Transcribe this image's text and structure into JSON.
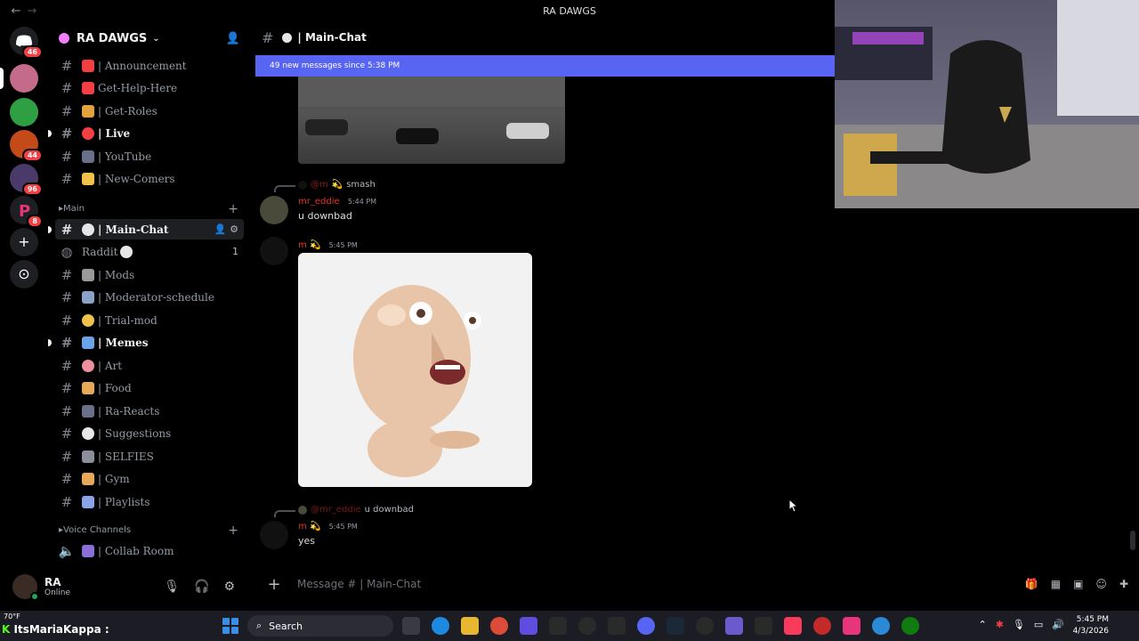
{
  "window": {
    "title": "RA DAWGS",
    "back": "←",
    "forward": "→"
  },
  "servers": {
    "badges": [
      "46",
      "44",
      "96",
      "8"
    ]
  },
  "server": {
    "name": "RA DAWGS"
  },
  "channels": [
    {
      "label": "| Announcement",
      "emoji_color": "#f23f43"
    },
    {
      "label": "Get-Help-Here",
      "emoji_color": "#f23f43"
    },
    {
      "label": "| Get-Roles",
      "emoji_color": "#e3a33c"
    },
    {
      "label": "| Live",
      "emoji_color": "#f23f43"
    },
    {
      "label": "| YouTube",
      "emoji_color": "#6a6f8a"
    },
    {
      "label": "| New-Comers",
      "emoji_color": "#f0c14b"
    }
  ],
  "category_main": "Main",
  "channels2": [
    {
      "label": "| Main-Chat",
      "emoji_color": "#e6e6e6"
    },
    {
      "label": "Raddit",
      "emoji_color": "#e6e6e6",
      "count": "1"
    },
    {
      "label": "| Mods",
      "emoji_color": "#9a9a9a"
    },
    {
      "label": "| Moderator-schedule",
      "emoji_color": "#8aa2c8"
    },
    {
      "label": "| Trial-mod",
      "emoji_color": "#f0c14b"
    },
    {
      "label": "| Memes",
      "emoji_color": "#6aa3e8"
    },
    {
      "label": "| Art",
      "emoji_color": "#f08fa0"
    },
    {
      "label": "| Food",
      "emoji_color": "#e8a85a"
    },
    {
      "label": "| Ra-Reacts",
      "emoji_color": "#6a6f8a"
    },
    {
      "label": "| Suggestions",
      "emoji_color": "#e6e6e6"
    },
    {
      "label": "| SELFIES",
      "emoji_color": "#8a8f9a"
    },
    {
      "label": "| Gym",
      "emoji_color": "#e8a85a"
    },
    {
      "label": "| Playlists",
      "emoji_color": "#8aa2e8"
    }
  ],
  "category_voice": "Voice Channels",
  "voice_channels": [
    {
      "label": "| Collab Room",
      "emoji_color": "#8a6fd8"
    }
  ],
  "user": {
    "name": "RA",
    "status": "Online"
  },
  "chat": {
    "channel_title": "| Main-Chat",
    "new_messages": "49 new messages since 5:38 PM",
    "messages": [
      {
        "reply_text": "smash",
        "author": "mr_eddie",
        "time": "5:44 PM",
        "text": "u downbad"
      },
      {
        "author": "m",
        "time": "5:45 PM"
      },
      {
        "reply_author": "@mr_eddie",
        "reply_text": "u downbad",
        "author": "m",
        "time": "5:45 PM",
        "text": "yes"
      }
    ],
    "input_placeholder": "Message # | Main-Chat"
  },
  "taskbar": {
    "weather": "70°F",
    "streamer_name": "ItsMariaKappa :",
    "search": "Search",
    "time": "5:45 PM",
    "date": "4/3/2026"
  }
}
